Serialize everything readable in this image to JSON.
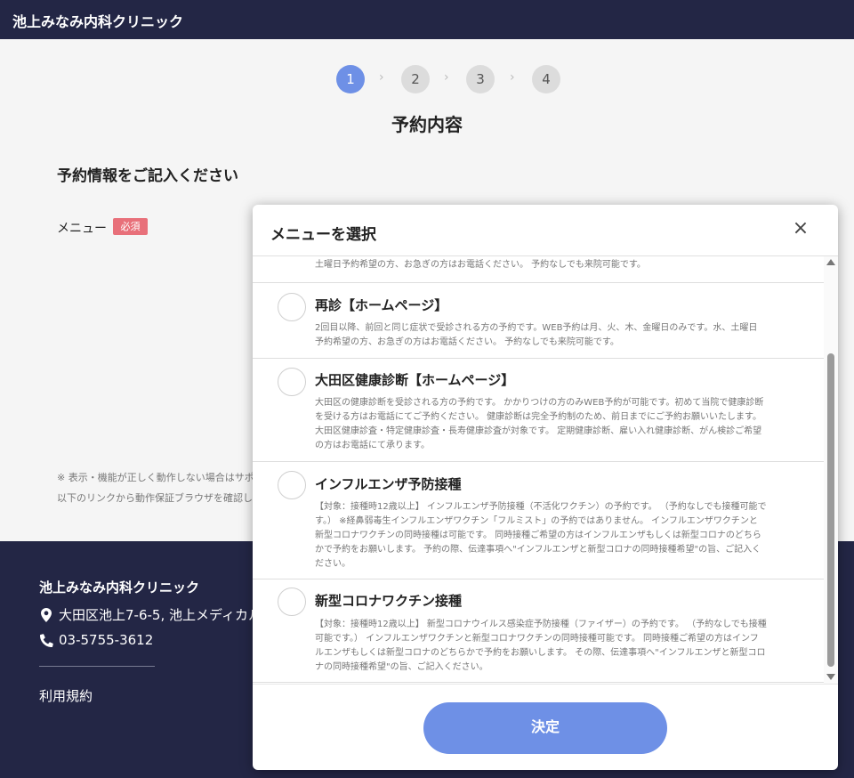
{
  "header": {
    "brand": "池上みなみ内科クリニック"
  },
  "steps": [
    {
      "label": "1",
      "active": true
    },
    {
      "label": "2",
      "active": false
    },
    {
      "label": "3",
      "active": false
    },
    {
      "label": "4",
      "active": false
    }
  ],
  "page_title": "予約内容",
  "form": {
    "section_title": "予約情報をご記入ください",
    "menu_label": "メニュー",
    "required_badge": "必須"
  },
  "notes": [
    "※ 表示・機能が正しく動作しない場合はサポ",
    "以下のリンクから動作保証ブラウザを確認し"
  ],
  "footer": {
    "name": "池上みなみ内科クリニック",
    "address": "大田区池上7-6-5, 池上メディカル",
    "phone": "03-5755-3612",
    "terms_link": "利用規約"
  },
  "modal": {
    "title": "メニューを選択",
    "close_icon": "×",
    "confirm_label": "決定",
    "partial_top_text": "土曜日予約希望の方、お急ぎの方はお電話ください。 予約なしでも来院可能です。",
    "items": [
      {
        "title": "再診【ホームページ】",
        "desc": [
          "2回目以降、前回と同じ症状で受診される方の予約です。WEB予約は月、火、木、金曜日のみです。水、土曜日",
          "予約希望の方、お急ぎの方はお電話ください。 予約なしでも来院可能です。"
        ]
      },
      {
        "title": "大田区健康診断【ホームページ】",
        "desc": [
          "大田区の健康診断を受診される方の予約です。 かかりつけの方のみWEB予約が可能です。初めて当院で健康診断",
          "を受ける方はお電話にてご予約ください。 健康診断は完全予約制のため、前日までにご予約お願いいたします。",
          "大田区健康診査・特定健康診査・長寿健康診査が対象です。 定期健康診断、雇い入れ健康診断、がん検診ご希望",
          "の方はお電話にて承ります。"
        ]
      },
      {
        "title": "インフルエンザ予防接種",
        "desc": [
          "【対象：接種時12歳以上】 インフルエンザ予防接種（不活化ワクチン）の予約です。 （予約なしでも接種可能で",
          "す。） ※経鼻弱毒生インフルエンザワクチン「フルミスト」の予約ではありません。 インフルエンザワクチンと",
          "新型コロナワクチンの同時接種は可能です。 同時接種ご希望の方はインフルエンザもしくは新型コロナのどちら",
          "かで予約をお願いします。 予約の際、伝達事項へ\"インフルエンザと新型コロナの同時接種希望\"の旨、ご記入く",
          "ださい。"
        ]
      },
      {
        "title": "新型コロナワクチン接種",
        "desc": [
          "【対象：接種時12歳以上】 新型コロナウイルス感染症予防接種（ファイザー）の予約です。 （予約なしでも接種",
          "可能です。） インフルエンザワクチンと新型コロナワクチンの同時接種可能です。 同時接種ご希望の方はインフ",
          "ルエンザもしくは新型コロナのどちらかで予約をお願いします。 その際、伝達事項へ\"インフルエンザと新型コロ",
          "ナの同時接種希望\"の旨、ご記入ください。"
        ]
      }
    ]
  }
}
